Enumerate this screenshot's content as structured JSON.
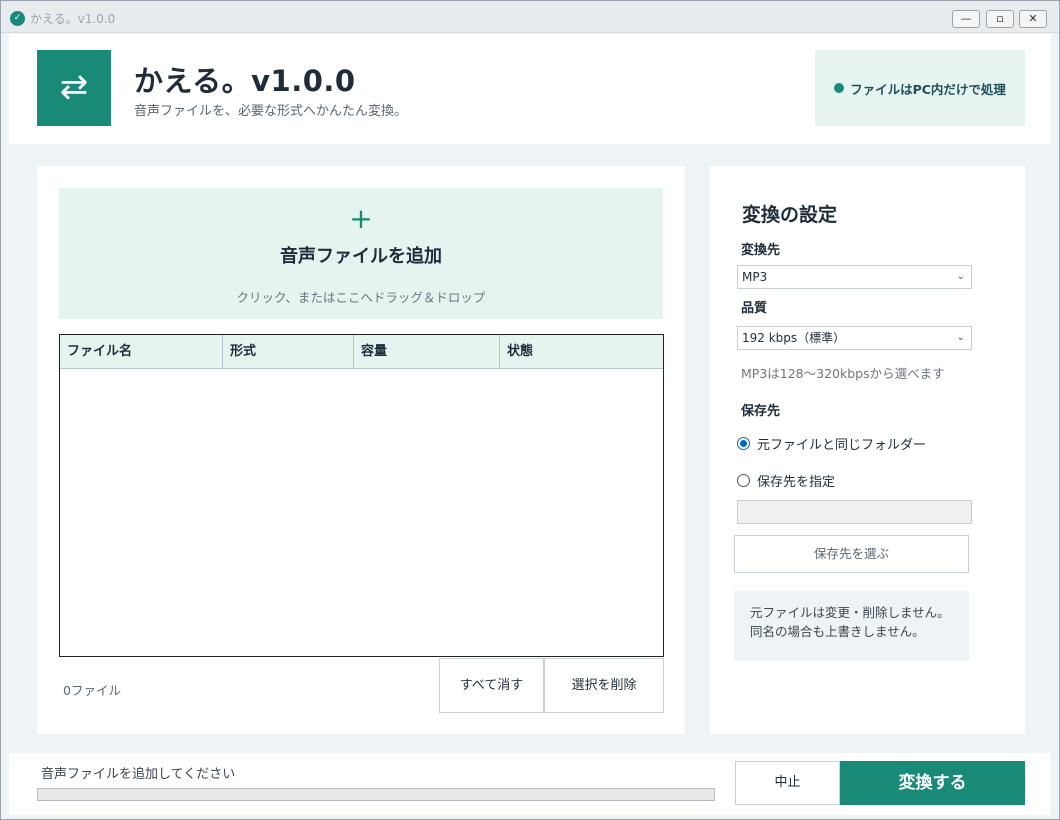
{
  "window": {
    "title": "かえる。v1.0.0",
    "icon": "frog-app-icon",
    "controls": {
      "minimize": "—",
      "maximize": "▫",
      "close": "✕"
    }
  },
  "header": {
    "logo_glyph": "⇄",
    "title": "かえる。v1.0.0",
    "subtitle": "音声ファイルを、必要な形式へかんたん変換。",
    "privacy_badge": "ファイルはPC内だけで処理"
  },
  "drop_zone": {
    "plus": "+",
    "title": "音声ファイルを追加",
    "hint": "クリック、またはここへドラッグ＆ドロップ"
  },
  "file_table": {
    "columns": [
      "ファイル名",
      "形式",
      "容量",
      "状態"
    ],
    "rows": []
  },
  "file_count": "0ファイル",
  "buttons": {
    "clear_all": "すべて消す",
    "remove_selected": "選択を削除",
    "choose_dest": "保存先を選ぶ",
    "stop": "中止",
    "convert": "変換する"
  },
  "settings": {
    "title": "変換の設定",
    "format_label": "変換先",
    "format_value": "MP3",
    "quality_label": "品質",
    "quality_value": "192 kbps（標準）",
    "quality_hint": "MP3は128〜320kbpsから選べます",
    "dest_label": "保存先",
    "dest_same": "元ファイルと同じフォルダー",
    "dest_custom": "保存先を指定",
    "dest_selected": "same",
    "dest_path": "",
    "note_line1": "元ファイルは変更・削除しません。",
    "note_line2": "同名の場合も上書きしません。"
  },
  "status": {
    "text": "音声ファイルを追加してください",
    "progress": 0
  },
  "colors": {
    "accent": "#1a8a78",
    "accent_light": "#e6f4f0",
    "radio_selected": "#0a66c2"
  }
}
